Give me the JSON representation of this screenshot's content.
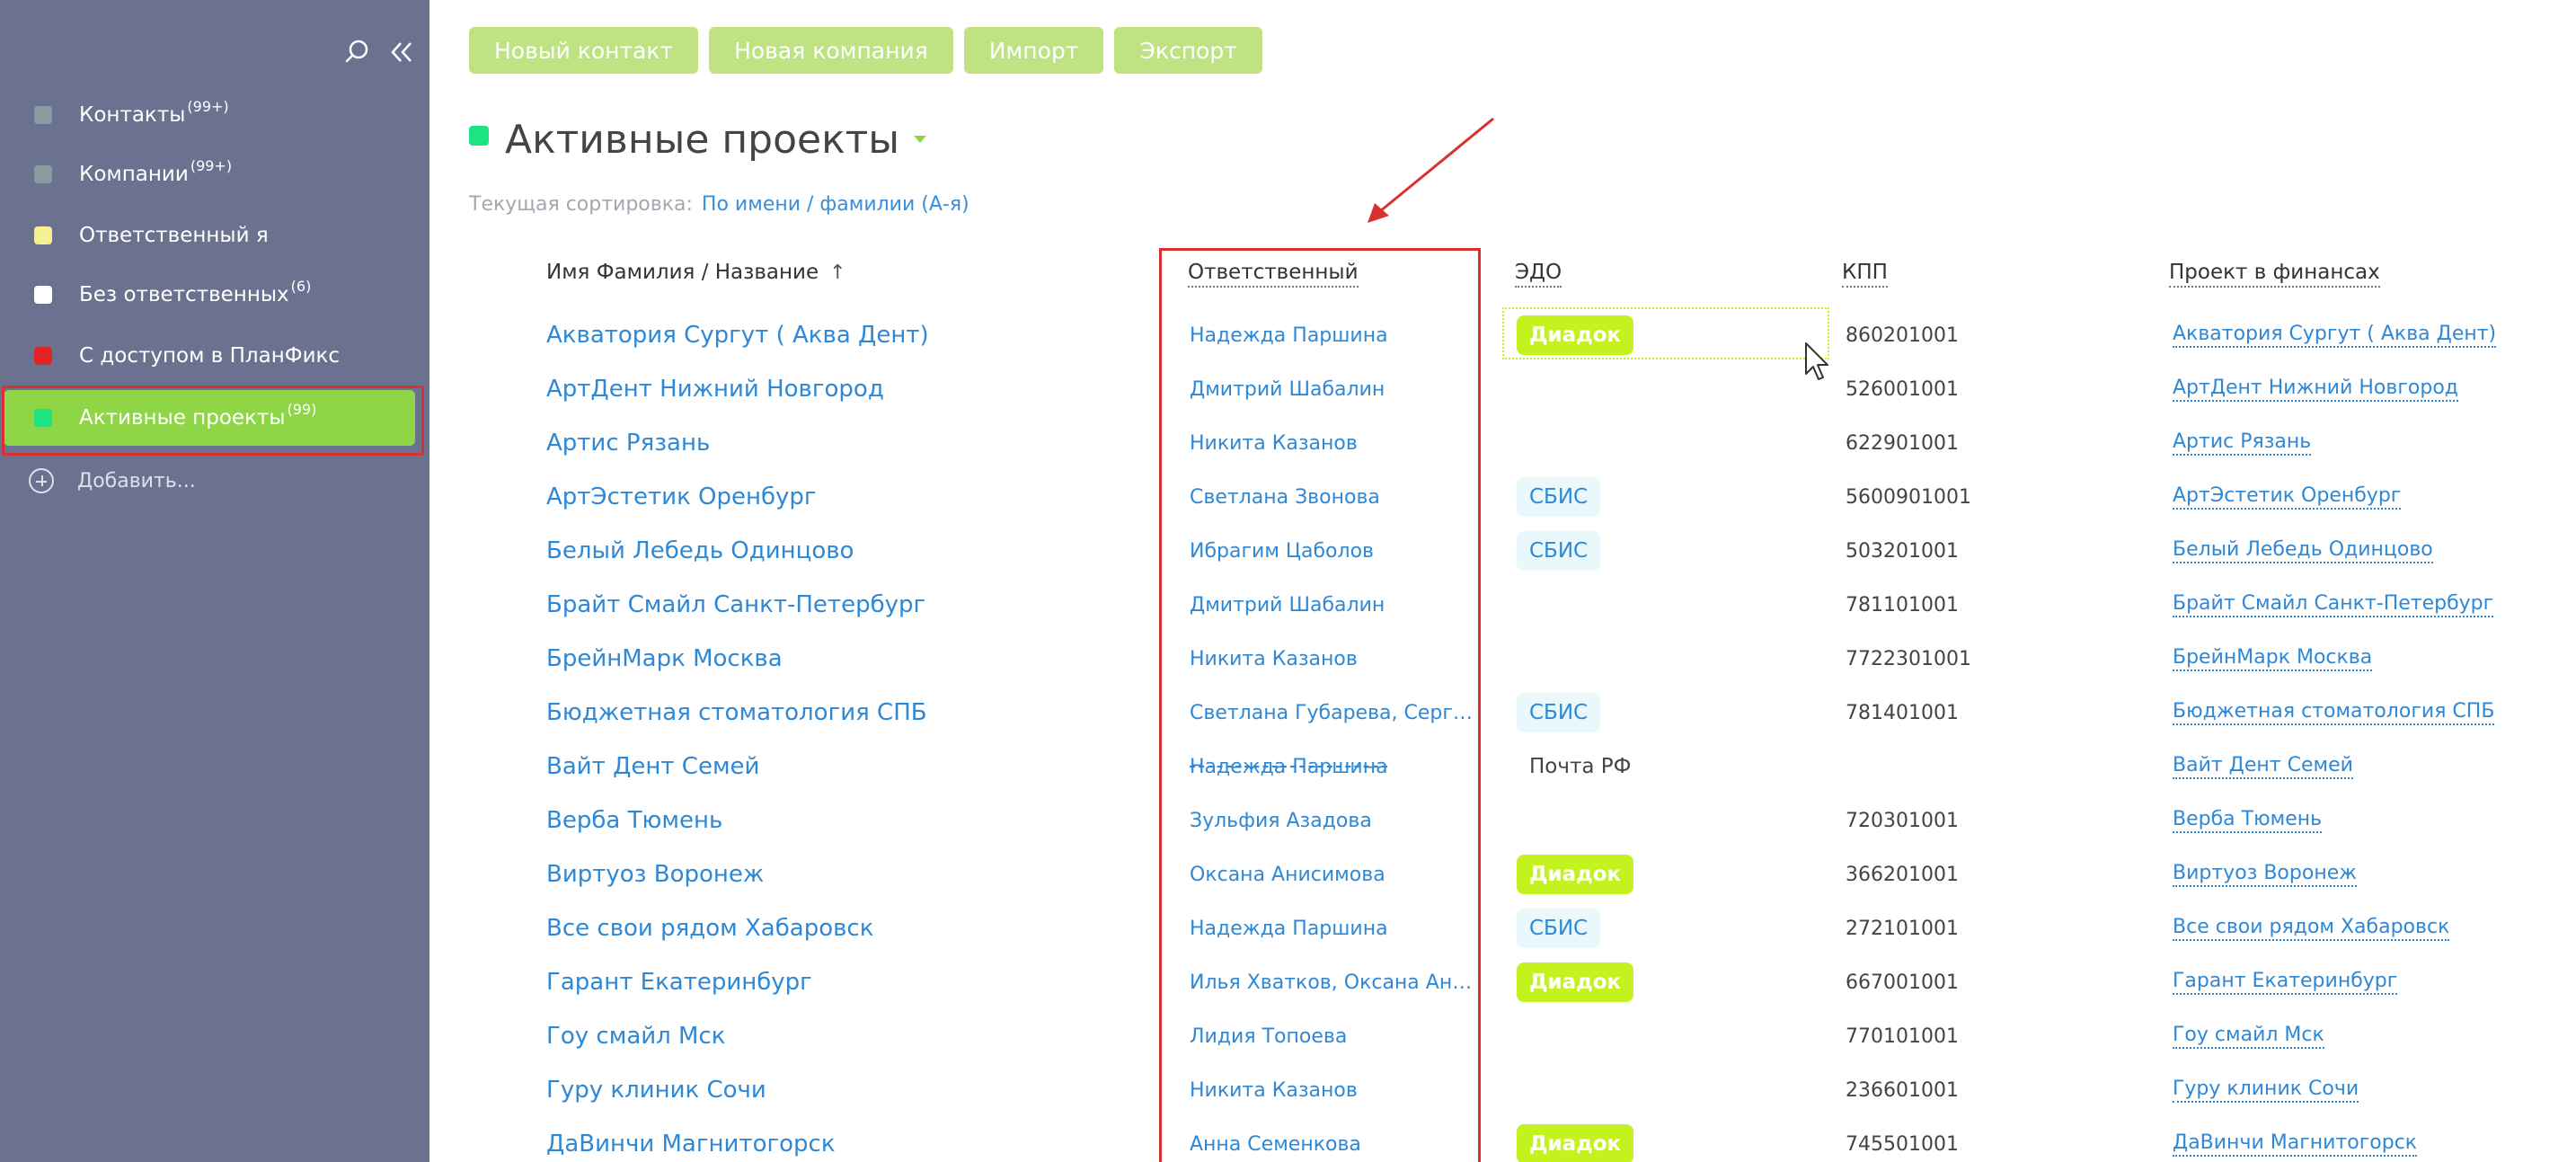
{
  "sidebar": {
    "items": [
      {
        "label": "Контакты",
        "count": "(99+)",
        "color": "#8a9aa0"
      },
      {
        "label": "Компании",
        "count": "(99+)",
        "color": "#8a9aa0"
      },
      {
        "label": "Ответственный я",
        "count": "",
        "color": "#f5f092"
      },
      {
        "label": "Без ответственных",
        "count": "(6)",
        "color": "#ffffff"
      },
      {
        "label": "С доступом в ПланФикс",
        "count": "",
        "color": "#e02424"
      },
      {
        "label": "Активные проекты",
        "count": "(99)",
        "color": "#1ee381"
      }
    ],
    "add_label": "Добавить..."
  },
  "toolbar": {
    "new_contact": "Новый контакт",
    "new_company": "Новая компания",
    "import": "Импорт",
    "export": "Экспорт"
  },
  "page": {
    "title": "Активные проекты",
    "sort_label": "Текущая сортировка:",
    "sort_value": "По имени / фамилии (А-я)"
  },
  "table": {
    "headers": {
      "name": "Имя Фамилия / Название",
      "responsible": "Ответственный",
      "edo": "ЭДО",
      "kpp": "КПП",
      "finance": "Проект в финансах"
    },
    "rows": [
      {
        "name": "Акватория Сургут ( Аква Дент)",
        "responsible": "Надежда Паршина",
        "edo": "Диадок",
        "kpp": "860201001",
        "finance": "Акватория Сургут ( Аква Дент)"
      },
      {
        "name": "АртДент Нижний Новгород",
        "responsible": "Дмитрий Шабалин",
        "edo": "",
        "kpp": "526001001",
        "finance": "АртДент Нижний Новгород"
      },
      {
        "name": "Артис Рязань",
        "responsible": "Никита Казанов",
        "edo": "",
        "kpp": "622901001",
        "finance": "Артис Рязань"
      },
      {
        "name": "АртЭстетик Оренбург",
        "responsible": "Светлана Звонова",
        "edo": "СБИС",
        "kpp": "5600901001",
        "finance": "АртЭстетик Оренбург"
      },
      {
        "name": "Белый Лебедь Одинцово",
        "responsible": "Ибрагим Цаболов",
        "edo": "СБИС",
        "kpp": "503201001",
        "finance": "Белый Лебедь Одинцово"
      },
      {
        "name": "Брайт Смайл Санкт-Петербург",
        "responsible": "Дмитрий Шабалин",
        "edo": "",
        "kpp": "781101001",
        "finance": "Брайт Смайл Санкт-Петербург"
      },
      {
        "name": "БрейнМарк Москва",
        "responsible": "Никита Казанов",
        "edo": "",
        "kpp": "7722301001",
        "finance": "БрейнМарк Москва"
      },
      {
        "name": "Бюджетная стоматология СПБ",
        "responsible": "Светлана Губарева, Сергей ...",
        "edo": "СБИС",
        "kpp": "781401001",
        "finance": "Бюджетная стоматология СПБ"
      },
      {
        "name": "Вайт Дент Семей",
        "responsible": "Надежда Паршина",
        "edo": "Почта РФ",
        "kpp": "",
        "finance": "Вайт Дент Семей"
      },
      {
        "name": "Верба Тюмень",
        "responsible": "Зульфия Азадова",
        "edo": "",
        "kpp": "720301001",
        "finance": "Верба Тюмень"
      },
      {
        "name": "Виртуоз Воронеж",
        "responsible": "Оксана Анисимова",
        "edo": "Диадок",
        "kpp": "366201001",
        "finance": "Виртуоз Воронеж"
      },
      {
        "name": "Все свои рядом Хабаровск",
        "responsible": "Надежда Паршина",
        "edo": "СБИС",
        "kpp": "272101001",
        "finance": "Все свои рядом Хабаровск"
      },
      {
        "name": "Гарант Екатеринбург",
        "responsible": "Илья Хватков, Оксана Анис...",
        "edo": "Диадок",
        "kpp": "667001001",
        "finance": "Гарант Екатеринбург"
      },
      {
        "name": "Гоу смайл Мск",
        "responsible": "Лидия Топоева",
        "edo": "",
        "kpp": "770101001",
        "finance": "Гоу смайл Мск"
      },
      {
        "name": "Гуру клиник Сочи",
        "responsible": "Никита Казанов",
        "edo": "",
        "kpp": "236601001",
        "finance": "Гуру клиник Сочи"
      },
      {
        "name": "ДаВинчи Магнитогорск",
        "responsible": "Анна Семенкова",
        "edo": "Диадок",
        "kpp": "745501001",
        "finance": "ДаВинчи Магнитогорск"
      }
    ]
  },
  "colors": {
    "sidebar_bg": "#6b7290",
    "active_green": "#8ed646",
    "button_green": "#bfe383",
    "link_blue": "#2e88d6",
    "diadoc": "#c4f21e",
    "highlight_red": "#d93030"
  }
}
